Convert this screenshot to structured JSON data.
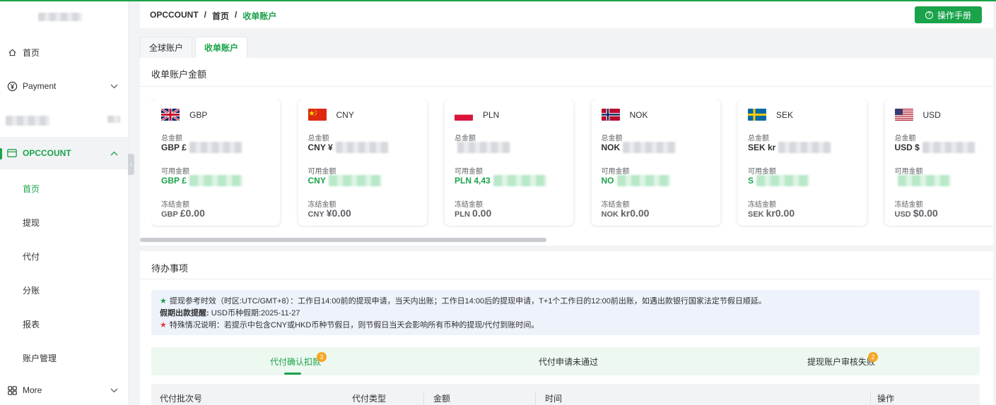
{
  "sidebar": {
    "items": [
      {
        "label": "首页",
        "icon": "home-icon"
      },
      {
        "label": "Payment",
        "icon": "yen-circle-icon"
      },
      {
        "label": "OPCCOUNT",
        "icon": "card-icon"
      },
      {
        "label": "More",
        "icon": "grid-icon"
      }
    ],
    "sub_items": [
      "首页",
      "提现",
      "代付",
      "分账",
      "报表",
      "账户管理"
    ]
  },
  "header": {
    "breadcrumb": [
      "OPCCOUNT",
      "首页",
      "收单账户"
    ],
    "manual_button": "操作手册"
  },
  "tabs": [
    "全球账户",
    "收单账户"
  ],
  "balances": {
    "title": "收单账户金额",
    "labels": {
      "total": "总金额",
      "available": "可用金额",
      "frozen": "冻结金额"
    },
    "cards": [
      {
        "currency": "GBP",
        "flag": "uk-flag-icon",
        "total_prefix": "GBP £",
        "available_prefix": "GBP £",
        "frozen_code": "GBP",
        "frozen_amount": "£0.00"
      },
      {
        "currency": "CNY",
        "flag": "china-flag-icon",
        "total_prefix": "CNY ¥",
        "available_prefix": "CNY",
        "frozen_code": "CNY",
        "frozen_amount": "¥0.00"
      },
      {
        "currency": "PLN",
        "flag": "poland-flag-icon",
        "total_prefix": "",
        "available_prefix": "PLN 4,43",
        "frozen_code": "PLN",
        "frozen_amount": "0.00"
      },
      {
        "currency": "NOK",
        "flag": "norway-flag-icon",
        "total_prefix": "NOK",
        "available_prefix": "NO",
        "frozen_code": "NOK",
        "frozen_amount": "kr0.00"
      },
      {
        "currency": "SEK",
        "flag": "sweden-flag-icon",
        "total_prefix": "SEK kr",
        "available_prefix": "S",
        "frozen_code": "SEK",
        "frozen_amount": "kr0.00"
      },
      {
        "currency": "USD",
        "flag": "usa-flag-icon",
        "total_prefix": "USD $",
        "available_prefix": "",
        "frozen_code": "USD",
        "frozen_amount": "$0.00"
      }
    ]
  },
  "todo": {
    "title": "待办事项",
    "notice": {
      "line1": "提现参考时效（时区:UTC/GMT+8）：工作日14:00前的提现申请，当天内出账；工作日14:00后的提现申请，T+1个工作日的12:00前出账，如遇出款银行国家法定节假日顺延。",
      "line2_label": "假期出款提醒:",
      "line2_text": " USD币种假期:2025-11-27",
      "line3": "特殊情况说明：若提示中包含CNY或HKD币种节假日，则节假日当天会影响所有币种的提现/代付到账时间。"
    },
    "subtabs": [
      {
        "label": "代付确认扣款",
        "badge": "3"
      },
      {
        "label": "代付申请未通过",
        "badge": ""
      },
      {
        "label": "提现账户审核失败",
        "badge": "2"
      }
    ],
    "columns": [
      "代付批次号",
      "代付类型",
      "金额",
      "时间",
      "操作"
    ]
  },
  "colors": {
    "accent": "#1aa34a",
    "badge": "#f5a623",
    "notice_bg": "#eef2fb"
  }
}
